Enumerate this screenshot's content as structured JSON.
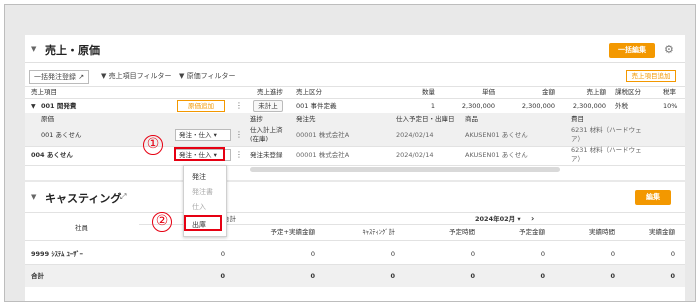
{
  "sales_section": {
    "title": "売上・原価",
    "bulk_edit_button": "一括編集",
    "toolbar": {
      "bulk_order": "一括発注登録",
      "sales_filter": "売上項目フィルター",
      "cost_filter": "原価フィルター",
      "add_sales_item": "売上項目追加"
    },
    "header1": [
      "売上項目",
      "売上進捗",
      "売上区分",
      "数量",
      "単価",
      "金額",
      "売上額",
      "課税区分",
      "税率"
    ],
    "row_main": {
      "code_name": "001 開発費",
      "add_cost": "原価追加",
      "progress": "未計上",
      "category": "001 事件定義",
      "qty": "1",
      "unit_price": "2,300,000",
      "amount": "2,300,000",
      "sales_amount": "2,300,000",
      "tax_type": "外税",
      "tax_rate": "10%"
    },
    "header2": [
      "原価",
      "進捗",
      "発注先",
      "仕入予定日・出庫日",
      "商品",
      "費目"
    ],
    "cost_rows": [
      {
        "code_name": "001 あくせん",
        "dropdown": "発注・仕入",
        "progress_l1": "仕入計上済",
        "progress_l2": "(在庫)",
        "supplier": "00001 株式会社A",
        "date": "2024/02/14",
        "product": "AKUSEN01 あくせん",
        "expense_l1": "6231 材料（ハードウェ",
        "expense_l2": "ア）"
      },
      {
        "code_name": "004 あくせん",
        "dropdown": "発注・仕入",
        "progress_l1": "発注未登録",
        "supplier": "00001 株式会社A",
        "date": "2024/02/14",
        "product": "AKUSEN01 あくせん",
        "expense_l1": "6231 材料（ハードウェ",
        "expense_l2": "ア）"
      }
    ]
  },
  "dropdown_menu": {
    "items": [
      "発注",
      "発注書",
      "仕入",
      "出庫"
    ]
  },
  "callouts": [
    "①",
    "②"
  ],
  "casting_section": {
    "title": "キャスティング",
    "edit_button": "編集",
    "col_member": "社員",
    "col_total": "合計",
    "month": "2024年02月",
    "sub_headers": [
      "予定+実績金額",
      "ｷｬｽﾃｨﾝｸﾞ計",
      "予定時間",
      "予定金額",
      "実績時間",
      "実績金額"
    ],
    "row": {
      "name": "9999 ｼｽﾃﾑ ﾕｰｻﾞｰ",
      "values": [
        "0",
        "0",
        "0",
        "0",
        "0",
        "0",
        "0"
      ]
    },
    "total_row": {
      "label": "合計",
      "values": [
        "0",
        "0",
        "0",
        "0",
        "0",
        "0",
        "0"
      ]
    }
  }
}
